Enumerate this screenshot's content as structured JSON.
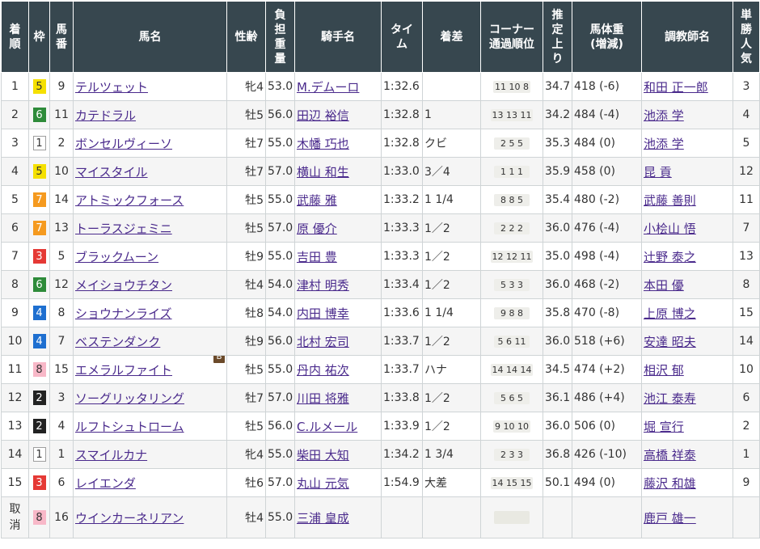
{
  "headers": {
    "rank": "着\n順",
    "waku": "枠",
    "umaban": "馬\n番",
    "horse": "馬名",
    "sexage": "性齢",
    "weight": "負\n担\n重\n量",
    "jockey": "騎手名",
    "time": "タイ\nム",
    "margin": "着差",
    "corner": "コーナー\n通過順位",
    "last3f": "推\n定\n上\nり",
    "bodyweight": "馬体重\n(増減)",
    "trainer": "調教師名",
    "popularity": "単\n勝\n人\n気"
  },
  "waku_colors": {
    "1": {
      "bg": "#ffffff",
      "fg": "#333333"
    },
    "2": {
      "bg": "#222222",
      "fg": "#ffffff"
    },
    "3": {
      "bg": "#e53935",
      "fg": "#ffffff"
    },
    "4": {
      "bg": "#1e6fd0",
      "fg": "#ffffff"
    },
    "5": {
      "bg": "#f5e000",
      "fg": "#333333"
    },
    "6": {
      "bg": "#2e8b3a",
      "fg": "#ffffff"
    },
    "7": {
      "bg": "#f59a1f",
      "fg": "#ffffff"
    },
    "8": {
      "bg": "#f8b8c8",
      "fg": "#333333"
    }
  },
  "rows": [
    {
      "rank": "1",
      "waku": "5",
      "umaban": "9",
      "horse": "テルツェット",
      "blinker": "",
      "sexage": "牝4",
      "weight": "53.0",
      "jockey": "M.デムーロ",
      "time": "1:32.6",
      "margin": "",
      "corner": "11 10 8",
      "last3f": "34.7",
      "bodyweight": "418 (-6)",
      "trainer": "和田 正一郎",
      "popularity": "3"
    },
    {
      "rank": "2",
      "waku": "6",
      "umaban": "11",
      "horse": "カテドラル",
      "blinker": "",
      "sexage": "牡5",
      "weight": "56.0",
      "jockey": "田辺 裕信",
      "time": "1:32.8",
      "margin": "1",
      "corner": "13 13 11",
      "last3f": "34.2",
      "bodyweight": "484 (-4)",
      "trainer": "池添 学",
      "popularity": "4"
    },
    {
      "rank": "3",
      "waku": "1",
      "umaban": "2",
      "horse": "ボンセルヴィーソ",
      "blinker": "",
      "sexage": "牡7",
      "weight": "55.0",
      "jockey": "木幡 巧也",
      "time": "1:32.8",
      "margin": "クビ",
      "corner": "2 5 5",
      "last3f": "35.3",
      "bodyweight": "484 (0)",
      "trainer": "池添 学",
      "popularity": "5"
    },
    {
      "rank": "4",
      "waku": "5",
      "umaban": "10",
      "horse": "マイスタイル",
      "blinker": "",
      "sexage": "牡7",
      "weight": "57.0",
      "jockey": "横山 和生",
      "time": "1:33.0",
      "margin": "3／4",
      "corner": "1 1 1",
      "last3f": "35.9",
      "bodyweight": "458 (0)",
      "trainer": "昆 貢",
      "popularity": "12"
    },
    {
      "rank": "5",
      "waku": "7",
      "umaban": "14",
      "horse": "アトミックフォース",
      "blinker": "",
      "sexage": "牡5",
      "weight": "55.0",
      "jockey": "武藤 雅",
      "time": "1:33.2",
      "margin": "1 1/4",
      "corner": "8 8 5",
      "last3f": "35.4",
      "bodyweight": "480 (-2)",
      "trainer": "武藤 善則",
      "popularity": "11"
    },
    {
      "rank": "6",
      "waku": "7",
      "umaban": "13",
      "horse": "トーラスジェミニ",
      "blinker": "",
      "sexage": "牡5",
      "weight": "57.0",
      "jockey": "原 優介",
      "time": "1:33.3",
      "margin": "1／2",
      "corner": "2 2 2",
      "last3f": "36.0",
      "bodyweight": "476 (-4)",
      "trainer": "小桧山 悟",
      "popularity": "7"
    },
    {
      "rank": "7",
      "waku": "3",
      "umaban": "5",
      "horse": "ブラックムーン",
      "blinker": "",
      "sexage": "牡9",
      "weight": "55.0",
      "jockey": "吉田 豊",
      "time": "1:33.3",
      "margin": "1／2",
      "corner": "12 12 11",
      "last3f": "35.0",
      "bodyweight": "498 (-4)",
      "trainer": "辻野 泰之",
      "popularity": "13"
    },
    {
      "rank": "8",
      "waku": "6",
      "umaban": "12",
      "horse": "メイショウチタン",
      "blinker": "",
      "sexage": "牡4",
      "weight": "54.0",
      "jockey": "津村 明秀",
      "time": "1:33.4",
      "margin": "1／2",
      "corner": "5 3 3",
      "last3f": "36.0",
      "bodyweight": "468 (-2)",
      "trainer": "本田 優",
      "popularity": "8"
    },
    {
      "rank": "9",
      "waku": "4",
      "umaban": "8",
      "horse": "ショウナンライズ",
      "blinker": "",
      "sexage": "牡8",
      "weight": "54.0",
      "jockey": "内田 博幸",
      "time": "1:33.6",
      "margin": "1 1/4",
      "corner": "9 8 8",
      "last3f": "35.8",
      "bodyweight": "470 (-8)",
      "trainer": "上原 博之",
      "popularity": "15"
    },
    {
      "rank": "10",
      "waku": "4",
      "umaban": "7",
      "horse": "ベステンダンク",
      "blinker": "",
      "sexage": "牡9",
      "weight": "56.0",
      "jockey": "北村 宏司",
      "time": "1:33.7",
      "margin": "1／2",
      "corner": "5 6 11",
      "last3f": "36.0",
      "bodyweight": "518 (+6)",
      "trainer": "安達 昭夫",
      "popularity": "14"
    },
    {
      "rank": "11",
      "waku": "8",
      "umaban": "15",
      "horse": "エメラルファイト",
      "blinker": "B",
      "sexage": "牡5",
      "weight": "55.0",
      "jockey": "丹内 祐次",
      "time": "1:33.7",
      "margin": "ハナ",
      "corner": "14 14 14",
      "last3f": "34.5",
      "bodyweight": "474 (+2)",
      "trainer": "相沢 郁",
      "popularity": "10"
    },
    {
      "rank": "12",
      "waku": "2",
      "umaban": "3",
      "horse": "ソーグリッタリング",
      "blinker": "",
      "sexage": "牡7",
      "weight": "57.0",
      "jockey": "川田 将雅",
      "time": "1:33.8",
      "margin": "1／2",
      "corner": "5 6 5",
      "last3f": "36.1",
      "bodyweight": "486 (+4)",
      "trainer": "池江 泰寿",
      "popularity": "6"
    },
    {
      "rank": "13",
      "waku": "2",
      "umaban": "4",
      "horse": "ルフトシュトローム",
      "blinker": "",
      "sexage": "牡5",
      "weight": "56.0",
      "jockey": "C.ルメール",
      "time": "1:33.9",
      "margin": "1／2",
      "corner": "9 10 10",
      "last3f": "36.0",
      "bodyweight": "506 (0)",
      "trainer": "堀 宣行",
      "popularity": "2"
    },
    {
      "rank": "14",
      "waku": "1",
      "umaban": "1",
      "horse": "スマイルカナ",
      "blinker": "",
      "sexage": "牝4",
      "weight": "55.0",
      "jockey": "柴田 大知",
      "time": "1:34.2",
      "margin": "1 3/4",
      "corner": "2 3 3",
      "last3f": "36.8",
      "bodyweight": "426 (-10)",
      "trainer": "高橋 祥泰",
      "popularity": "1"
    },
    {
      "rank": "15",
      "waku": "3",
      "umaban": "6",
      "horse": "レイエンダ",
      "blinker": "",
      "sexage": "牡6",
      "weight": "57.0",
      "jockey": "丸山 元気",
      "time": "1:54.9",
      "margin": "大差",
      "corner": "14 15 15",
      "last3f": "50.1",
      "bodyweight": "494 (0)",
      "trainer": "藤沢 和雄",
      "popularity": "9"
    },
    {
      "rank": "取\n消",
      "waku": "8",
      "umaban": "16",
      "horse": "ウインカーネリアン",
      "blinker": "",
      "sexage": "牡4",
      "weight": "55.0",
      "jockey": "三浦 皇成",
      "time": "",
      "margin": "",
      "corner": "",
      "last3f": "",
      "bodyweight": "",
      "trainer": "鹿戸 雄一",
      "popularity": ""
    }
  ]
}
